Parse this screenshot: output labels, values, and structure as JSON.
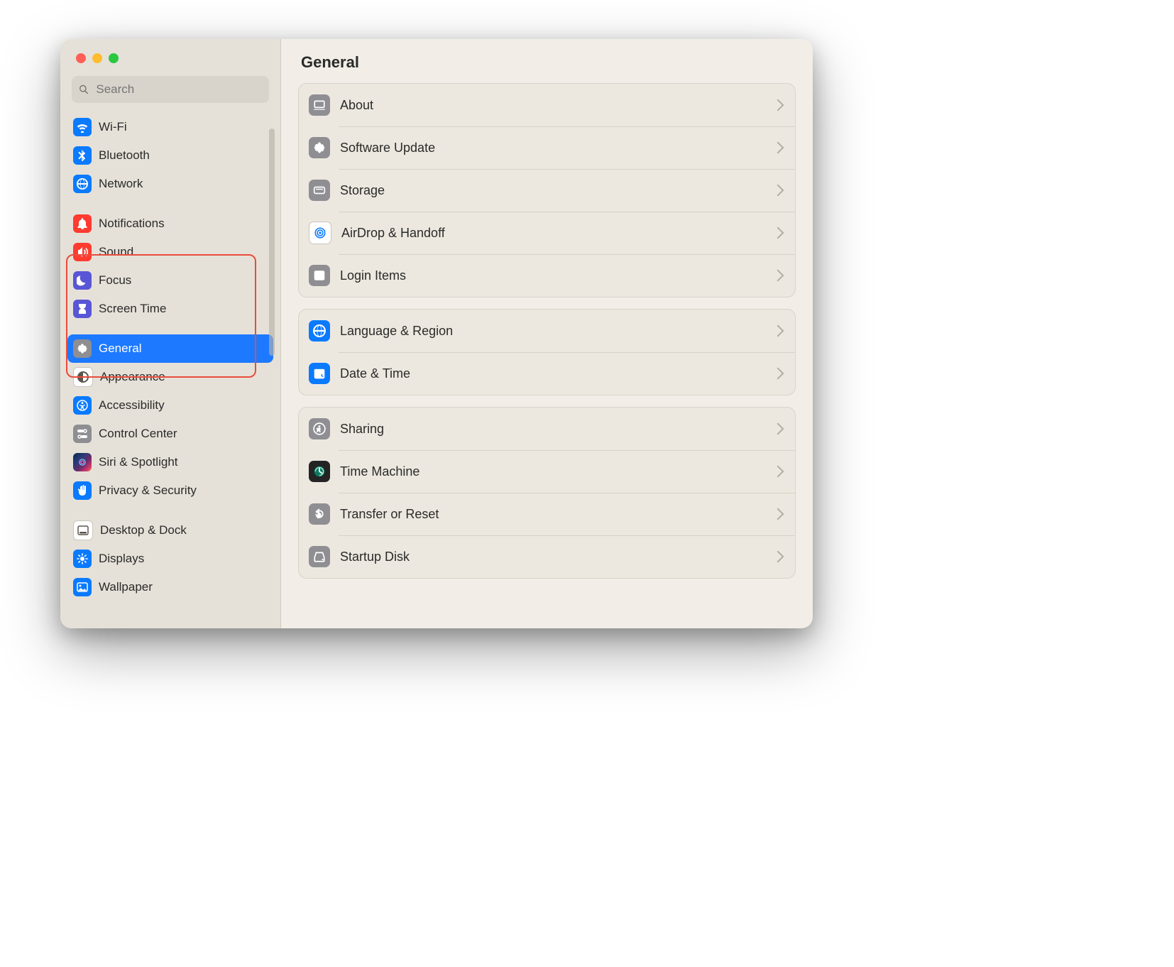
{
  "window": {
    "title": "General"
  },
  "search": {
    "placeholder": "Search"
  },
  "sidebar": {
    "items": [
      {
        "id": "wifi",
        "label": "Wi-Fi",
        "icon": "wifi-icon",
        "color": "ic-blue"
      },
      {
        "id": "bluetooth",
        "label": "Bluetooth",
        "icon": "bluetooth-icon",
        "color": "ic-blue"
      },
      {
        "id": "network",
        "label": "Network",
        "icon": "globe-icon",
        "color": "ic-blue"
      },
      {
        "gap": true
      },
      {
        "id": "notifications",
        "label": "Notifications",
        "icon": "bell-icon",
        "color": "ic-red"
      },
      {
        "id": "sound",
        "label": "Sound",
        "icon": "speaker-icon",
        "color": "ic-red"
      },
      {
        "id": "focus",
        "label": "Focus",
        "icon": "moon-icon",
        "color": "ic-indigo"
      },
      {
        "id": "screen-time",
        "label": "Screen Time",
        "icon": "hourglass-icon",
        "color": "ic-indigo"
      },
      {
        "gap": true
      },
      {
        "id": "general",
        "label": "General",
        "icon": "gear-icon",
        "color": "ic-gray",
        "selected": true
      },
      {
        "id": "appearance",
        "label": "Appearance",
        "icon": "appearance-icon",
        "color": "grayline"
      },
      {
        "id": "accessibility",
        "label": "Accessibility",
        "icon": "accessibility-icon",
        "color": "ic-blue"
      },
      {
        "id": "control-center",
        "label": "Control Center",
        "icon": "switches-icon",
        "color": "ic-gray"
      },
      {
        "id": "siri-spotlight",
        "label": "Siri & Spotlight",
        "icon": "siri-icon",
        "color": "ic-siri"
      },
      {
        "id": "privacy-security",
        "label": "Privacy & Security",
        "icon": "hand-icon",
        "color": "ic-blue"
      },
      {
        "gap": true
      },
      {
        "id": "desktop-dock",
        "label": "Desktop & Dock",
        "icon": "dock-icon",
        "color": "grayline"
      },
      {
        "id": "displays",
        "label": "Displays",
        "icon": "brightness-icon",
        "color": "ic-blue"
      },
      {
        "id": "wallpaper",
        "label": "Wallpaper",
        "icon": "wallpaper-icon",
        "color": "ic-blue"
      }
    ]
  },
  "main": {
    "groups": [
      {
        "rows": [
          {
            "id": "about",
            "label": "About",
            "icon": "laptop-icon",
            "style": "gray"
          },
          {
            "id": "software-update",
            "label": "Software Update",
            "icon": "gear-icon",
            "style": "gray"
          },
          {
            "id": "storage",
            "label": "Storage",
            "icon": "disk-icon",
            "style": "gray"
          },
          {
            "id": "airdrop-handoff",
            "label": "AirDrop & Handoff",
            "icon": "airdrop-icon",
            "style": "white"
          },
          {
            "id": "login-items",
            "label": "Login Items",
            "icon": "list-icon",
            "style": "gray"
          }
        ]
      },
      {
        "rows": [
          {
            "id": "language-region",
            "label": "Language & Region",
            "icon": "globe-icon",
            "style": "blue"
          },
          {
            "id": "date-time",
            "label": "Date & Time",
            "icon": "calendar-clock-icon",
            "style": "blue"
          }
        ]
      },
      {
        "rows": [
          {
            "id": "sharing",
            "label": "Sharing",
            "icon": "person-walk-icon",
            "style": "gray"
          },
          {
            "id": "time-machine",
            "label": "Time Machine",
            "icon": "timemachine-icon",
            "style": "black"
          },
          {
            "id": "transfer-reset",
            "label": "Transfer or Reset",
            "icon": "undo-icon",
            "style": "gray"
          },
          {
            "id": "startup-disk",
            "label": "Startup Disk",
            "icon": "drive-icon",
            "style": "gray"
          }
        ]
      }
    ]
  }
}
